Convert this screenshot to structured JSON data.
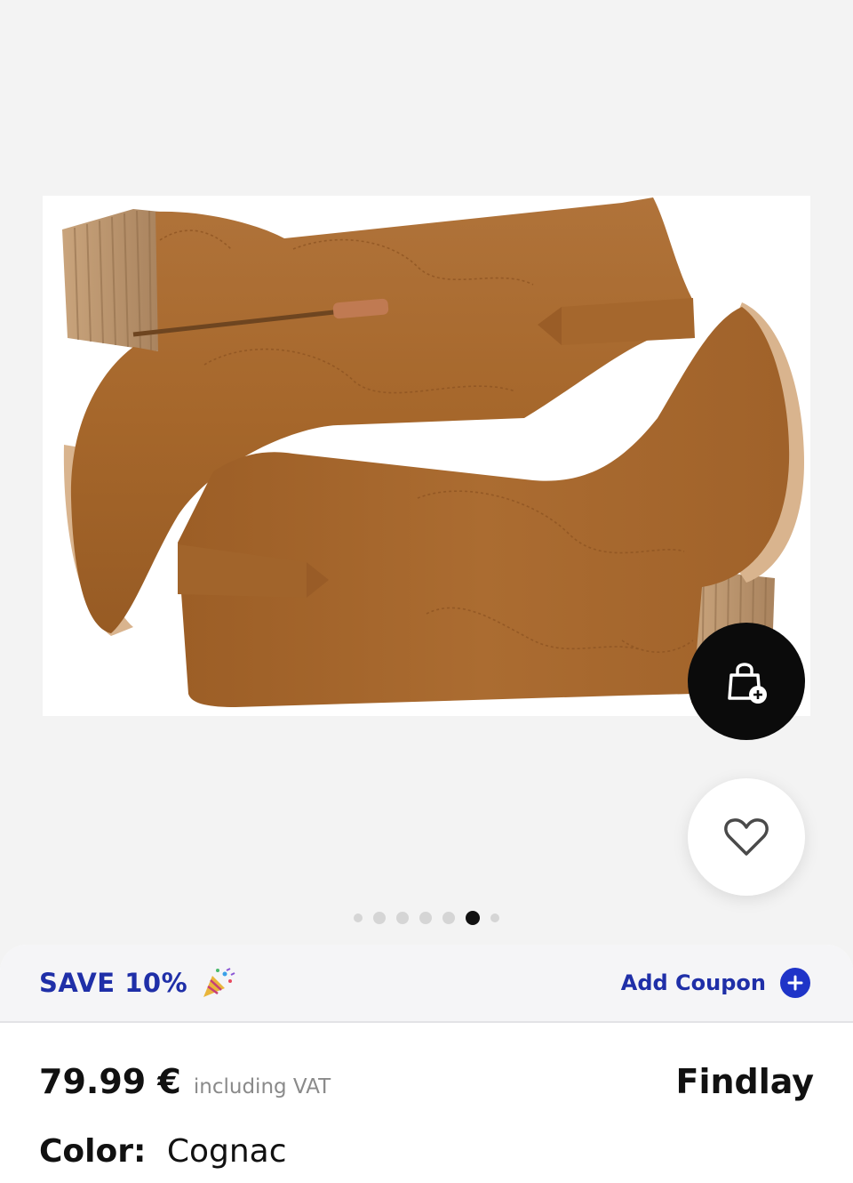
{
  "product": {
    "image_alt": "Cognac suede western boots"
  },
  "actions": {
    "add_to_bag_icon": "bag-plus-icon",
    "wishlist_icon": "heart-icon"
  },
  "carousel": {
    "total": 7,
    "active_index": 5
  },
  "coupon": {
    "save_text": "SAVE 10%",
    "save_emoji": "party-popper-icon",
    "add_coupon_label": "Add Coupon",
    "add_icon": "plus-circle-icon"
  },
  "pricing": {
    "price": "79.99 €",
    "vat_note": "including VAT",
    "brand": "Findlay"
  },
  "color": {
    "label": "Color:",
    "value": "Cognac"
  },
  "colors": {
    "accent": "#1f2fa8",
    "boot": "#a8692d",
    "fab_dark": "#0b0b0b"
  }
}
